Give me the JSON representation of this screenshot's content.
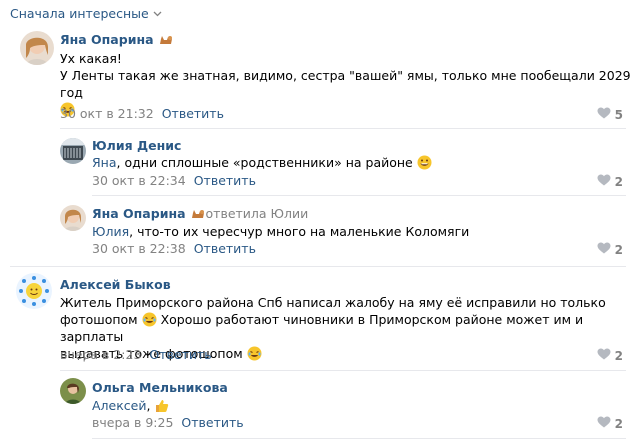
{
  "sort": {
    "label": "Сначала интересные"
  },
  "comments": [
    {
      "author": "Яна Опарина",
      "lines": [
        "Ух какая!",
        "У Ленты такая же знатная, видимо, сестра \"вашей\" ямы, только мне пообещали 2029 год"
      ],
      "time": "30 окт в 21:32",
      "reply": "Ответить",
      "likes": "5"
    },
    {
      "author": "Юлия Денис",
      "mention": "Яна",
      "text": ", одни сплошные «родственники» на районе",
      "time": "30 окт в 22:34",
      "reply": "Ответить",
      "likes": "2"
    },
    {
      "author": "Яна Опарина",
      "reply_to": "ответила Юлии",
      "mention": "Юлия",
      "text": ", что-то их чересчур много на маленькие Коломяги",
      "time": "30 окт в 22:38",
      "reply": "Ответить",
      "likes": "2"
    },
    {
      "author": "Алексей Быков",
      "line1": "Житель Приморского района Спб написал жалобу на яму её исправили но только",
      "line2a": "фотошопом",
      "line2b": " Хорошо работают чиновники в Приморском районе может им и зарплаты",
      "line3": "выдавать тоже фотошопом",
      "time": "вчера в 2:23",
      "reply": "Ответить",
      "likes": "2"
    },
    {
      "author": "Ольга Мельникова",
      "mention": "Алексей",
      "text": ",",
      "time": "вчера в 9:25",
      "reply": "Ответить",
      "likes": "2"
    }
  ],
  "colors": {
    "link": "#2a5885",
    "muted": "#828282",
    "divider": "#e7e8ec",
    "emoji": "#f7c52b"
  }
}
